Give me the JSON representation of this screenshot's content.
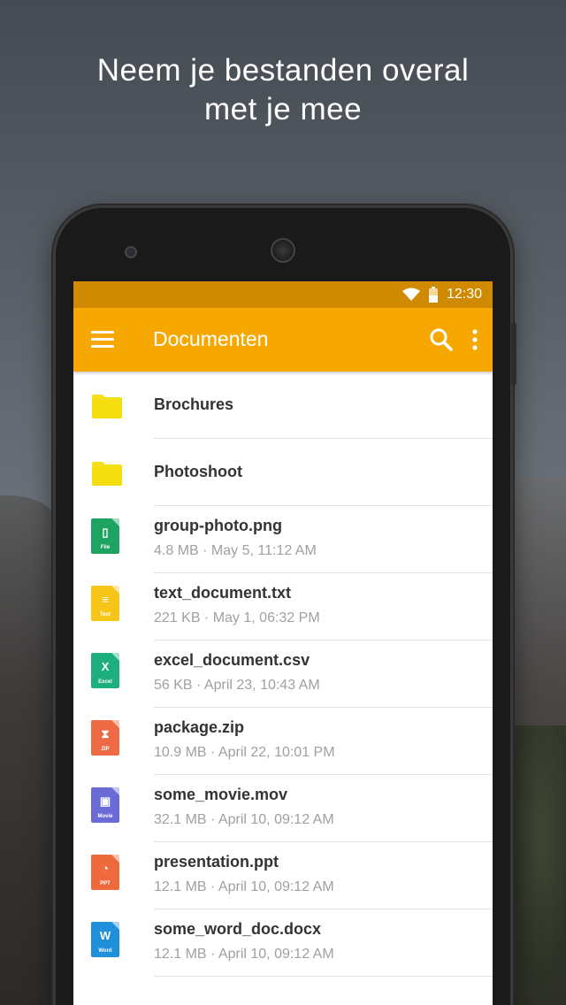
{
  "headline": {
    "line1": "Neem je bestanden overal",
    "line2": "met je mee"
  },
  "statusbar": {
    "time": "12:30",
    "icons": [
      "wifi-icon",
      "battery-icon"
    ]
  },
  "appbar": {
    "title": "Documenten",
    "icons": [
      "menu-icon",
      "search-icon",
      "more-vert-icon"
    ],
    "color": "#f6a800",
    "status_color": "#d08a00"
  },
  "folders": [
    {
      "name": "Brochures",
      "icon": "folder-icon",
      "color": "#f5df1a"
    },
    {
      "name": "Photoshoot",
      "icon": "folder-icon",
      "color": "#f5df1a"
    }
  ],
  "files": [
    {
      "name": "group-photo.png",
      "meta": "4.8 MB · May 5, 11:12 AM",
      "badge": "File",
      "glyph": "▯",
      "color": "#1ea362",
      "icon": "image-file-icon"
    },
    {
      "name": "text_document.txt",
      "meta": "221 KB · May 1, 06:32 PM",
      "badge": "Text",
      "glyph": "≡",
      "color": "#f5c518",
      "icon": "text-file-icon"
    },
    {
      "name": "excel_document.csv",
      "meta": "56 KB · April 23, 10:43 AM",
      "badge": "Excel",
      "glyph": "X",
      "color": "#1daf7e",
      "icon": "excel-file-icon"
    },
    {
      "name": "package.zip",
      "meta": "10.9 MB · April 22, 10:01 PM",
      "badge": "ZIP",
      "glyph": "⧗",
      "color": "#ee6a45",
      "icon": "zip-file-icon"
    },
    {
      "name": "some_movie.mov",
      "meta": "32.1 MB · April 10, 09:12 AM",
      "badge": "Movie",
      "glyph": "▣",
      "color": "#6b6bd8",
      "icon": "movie-file-icon"
    },
    {
      "name": "presentation.ppt",
      "meta": "12.1 MB · April 10, 09:12 AM",
      "badge": "PPT",
      "glyph": "◔",
      "color": "#ee6a3d",
      "icon": "ppt-file-icon"
    },
    {
      "name": "some_word_doc.docx",
      "meta": "12.1 MB · April 10, 09:12 AM",
      "badge": "Word",
      "glyph": "W",
      "color": "#1e8fd8",
      "icon": "word-file-icon"
    }
  ]
}
